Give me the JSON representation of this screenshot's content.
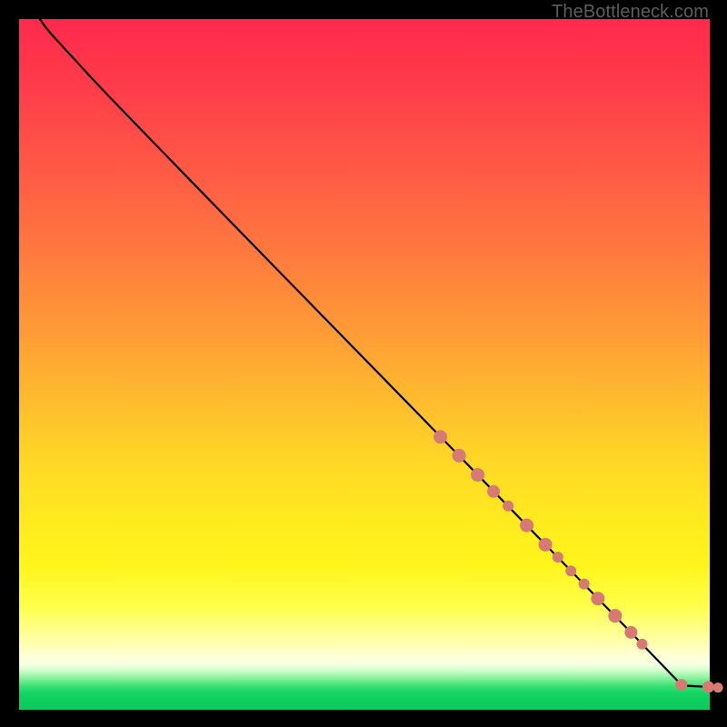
{
  "watermark": "TheBottleneck.com",
  "colors": {
    "dot": "#d87a74",
    "curve": "#000000"
  },
  "chart_data": {
    "type": "line",
    "title": "",
    "xlabel": "",
    "ylabel": "",
    "xlim": [
      0,
      100
    ],
    "ylim": [
      0,
      100
    ],
    "grid": false,
    "legend": false,
    "curve": [
      {
        "x": 3.0,
        "y": 100.0
      },
      {
        "x": 4.0,
        "y": 98.6
      },
      {
        "x": 5.5,
        "y": 96.9
      },
      {
        "x": 8.0,
        "y": 94.2
      },
      {
        "x": 11.0,
        "y": 90.9
      },
      {
        "x": 19.0,
        "y": 82.6
      },
      {
        "x": 30.0,
        "y": 71.3
      },
      {
        "x": 45.0,
        "y": 55.9
      },
      {
        "x": 60.0,
        "y": 40.6
      },
      {
        "x": 70.0,
        "y": 30.3
      },
      {
        "x": 80.0,
        "y": 20.0
      },
      {
        "x": 88.0,
        "y": 11.8
      },
      {
        "x": 93.0,
        "y": 6.6
      },
      {
        "x": 96.0,
        "y": 3.5
      }
    ],
    "connector": [
      {
        "x": 96.0,
        "y": 3.5
      },
      {
        "x": 100.0,
        "y": 3.3
      }
    ],
    "dots_along_curve": [
      {
        "x": 61.0,
        "y": 39.5,
        "r": 7.5
      },
      {
        "x": 63.7,
        "y": 36.8,
        "r": 7.5
      },
      {
        "x": 66.4,
        "y": 34.0,
        "r": 7.5
      },
      {
        "x": 68.7,
        "y": 31.6,
        "r": 7.0
      },
      {
        "x": 70.8,
        "y": 29.5,
        "r": 6.0
      },
      {
        "x": 73.5,
        "y": 26.7,
        "r": 7.5
      },
      {
        "x": 76.2,
        "y": 23.9,
        "r": 7.5
      },
      {
        "x": 78.0,
        "y": 22.1,
        "r": 6.0
      },
      {
        "x": 79.9,
        "y": 20.1,
        "r": 6.0
      },
      {
        "x": 81.8,
        "y": 18.2,
        "r": 6.0
      },
      {
        "x": 83.8,
        "y": 16.1,
        "r": 7.5
      },
      {
        "x": 86.3,
        "y": 13.6,
        "r": 7.5
      },
      {
        "x": 88.6,
        "y": 11.2,
        "r": 7.0
      },
      {
        "x": 90.2,
        "y": 9.5,
        "r": 6.0
      }
    ],
    "dots_extra": [
      {
        "x": 95.9,
        "y": 3.6,
        "r": 6.5
      },
      {
        "x": 99.8,
        "y": 3.3,
        "r": 6.5
      },
      {
        "x": 101.2,
        "y": 3.2,
        "r": 5.5
      }
    ]
  }
}
